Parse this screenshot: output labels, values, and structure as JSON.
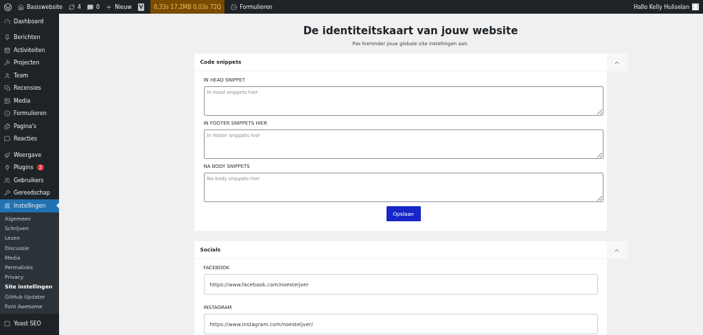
{
  "admin_bar": {
    "site": "Basiswebsite",
    "updates": "4",
    "comments": "0",
    "new": "Nieuw",
    "query_monitor": "0,33s 17,2MB 0,03s 72Q",
    "forms": "Formulieren",
    "greeting": "Hallo Kelly Huliselan"
  },
  "sidebar": {
    "groups": [
      [
        {
          "label": "Dashboard",
          "selected": false
        }
      ],
      [
        {
          "label": "Berichten",
          "selected": false
        },
        {
          "label": "Activiteiten",
          "selected": false
        },
        {
          "label": "Projecten",
          "selected": false
        },
        {
          "label": "Team",
          "selected": false
        },
        {
          "label": "Recensies",
          "selected": false
        },
        {
          "label": "Media",
          "selected": false
        },
        {
          "label": "Formulieren",
          "selected": false
        },
        {
          "label": "Pagina's",
          "selected": false
        },
        {
          "label": "Reacties",
          "selected": false
        }
      ],
      [
        {
          "label": "Weergave",
          "selected": false
        },
        {
          "label": "Plugins",
          "selected": false,
          "badge": "2"
        },
        {
          "label": "Gebruikers",
          "selected": false
        },
        {
          "label": "Gereedschap",
          "selected": false
        },
        {
          "label": "Instellingen",
          "selected": true,
          "children": [
            {
              "label": "Algemeen",
              "selected": false
            },
            {
              "label": "Schrijven",
              "selected": false
            },
            {
              "label": "Lezen",
              "selected": false
            },
            {
              "label": "Discussie",
              "selected": false
            },
            {
              "label": "Media",
              "selected": false
            },
            {
              "label": "Permalinks",
              "selected": false
            },
            {
              "label": "Privacy",
              "selected": false
            },
            {
              "label": "Site instellingen",
              "selected": true
            },
            {
              "label": "GitHub Updater",
              "selected": false
            },
            {
              "label": "Font Awesome",
              "selected": false
            }
          ]
        }
      ],
      [
        {
          "label": "Yoast SEO",
          "selected": false
        }
      ]
    ]
  },
  "page": {
    "title": "De identiteitskaart van jouw website",
    "subtitle": "Pas hieronder jouw globale site instellingen aan."
  },
  "panels": [
    {
      "title": "Code snippets",
      "expanded": true,
      "fields": [
        {
          "kind": "textarea",
          "label": "IN HEAD SNIPPET",
          "placeholder": "In head snippets hier"
        },
        {
          "kind": "textarea",
          "label": "IN FOOTER SNIPPETS HIER",
          "placeholder": "In footer snippets hier"
        },
        {
          "kind": "textarea",
          "label": "NA BODY SNIPPETS",
          "placeholder": "Na body snippets hier"
        }
      ],
      "button": "Opslaan"
    },
    {
      "title": "Socials",
      "expanded": true,
      "fields": [
        {
          "kind": "input",
          "label": "FACEBOOK",
          "value": "https://www.facebook.com/noesteijver"
        },
        {
          "kind": "input",
          "label": "INSTAGRAM",
          "value": "https://www.instagram.com/noesteijver/"
        }
      ]
    }
  ]
}
